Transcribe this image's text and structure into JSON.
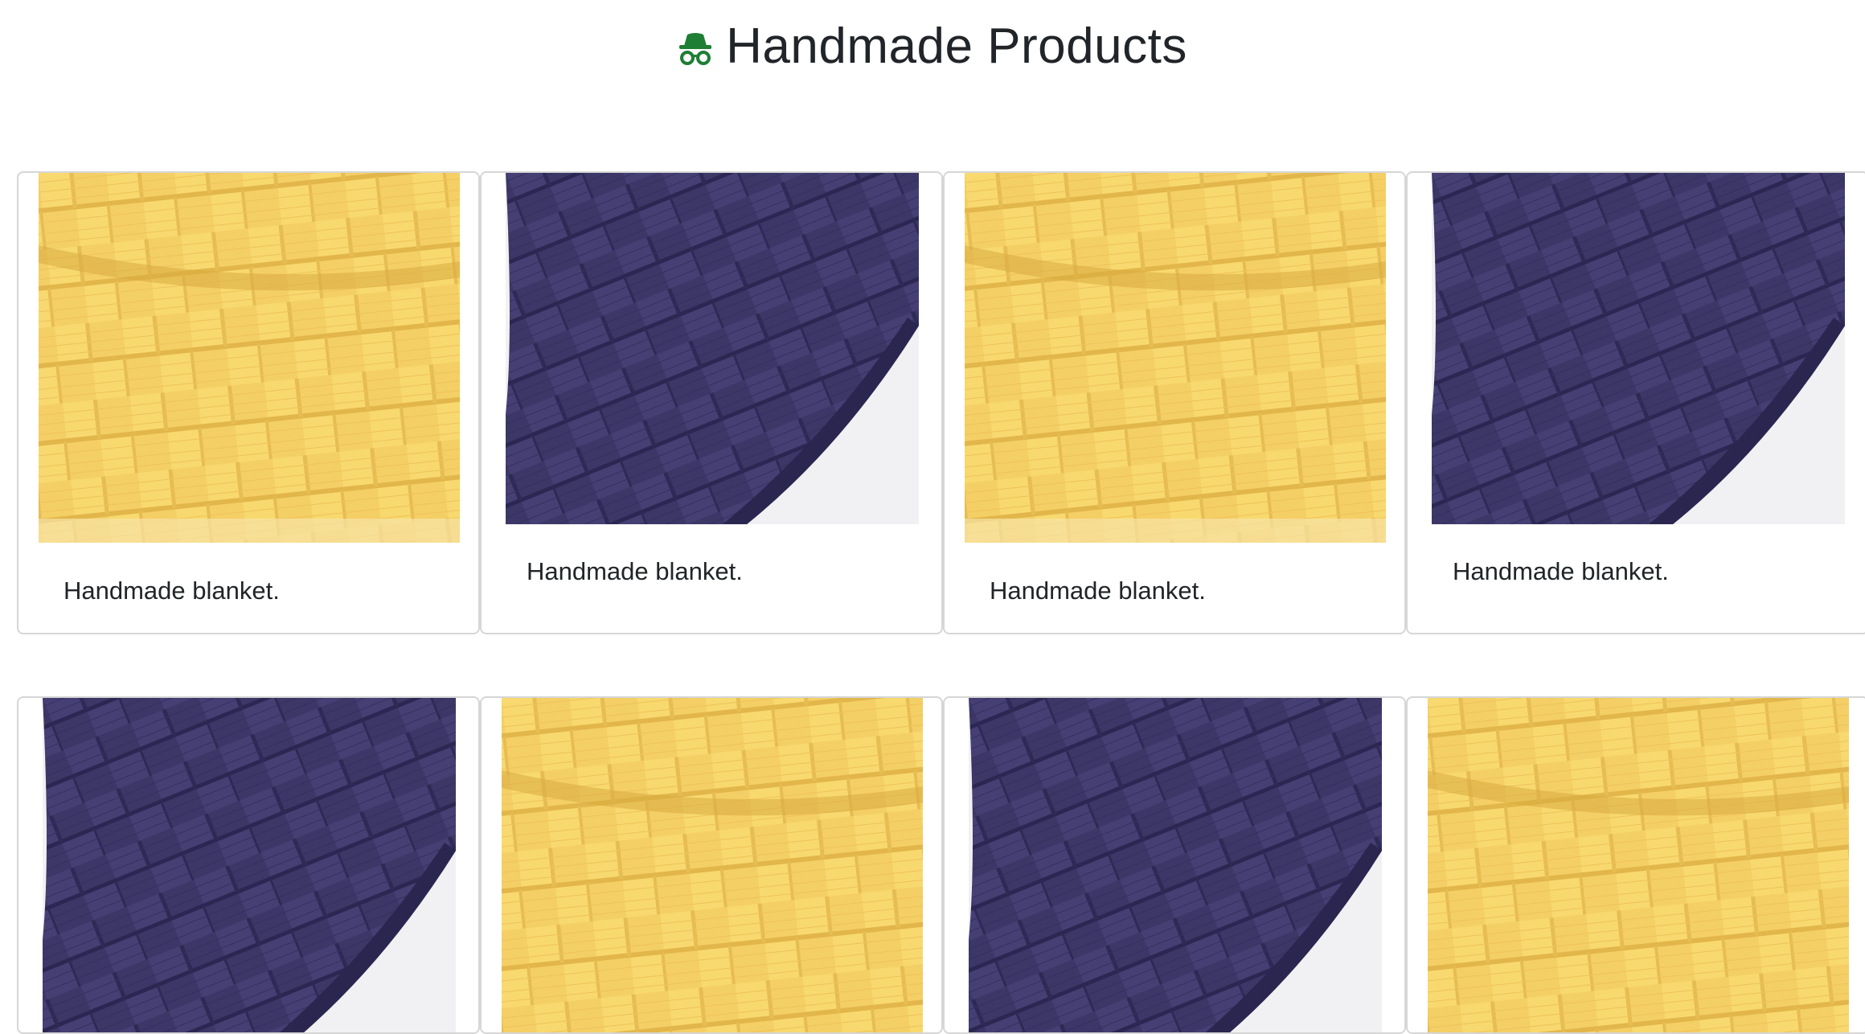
{
  "page": {
    "title": "Handmade Products",
    "icon": "incognito-spy-icon"
  },
  "colors": {
    "brand_icon": "#1e7e34",
    "yarn_yellow": "#f3cd63",
    "yarn_navy": "#3b3566"
  },
  "products": [
    {
      "caption": "Handmade blanket.",
      "image": "yellow-knit-blanket"
    },
    {
      "caption": "Handmade blanket.",
      "image": "navy-knit-blanket"
    },
    {
      "caption": "Handmade blanket.",
      "image": "yellow-knit-blanket"
    },
    {
      "caption": "Handmade blanket.",
      "image": "navy-knit-blanket"
    },
    {
      "caption": "",
      "image": "navy-knit-blanket"
    },
    {
      "caption": "",
      "image": "yellow-knit-blanket"
    },
    {
      "caption": "",
      "image": "navy-knit-blanket"
    },
    {
      "caption": "",
      "image": "yellow-knit-blanket"
    }
  ]
}
